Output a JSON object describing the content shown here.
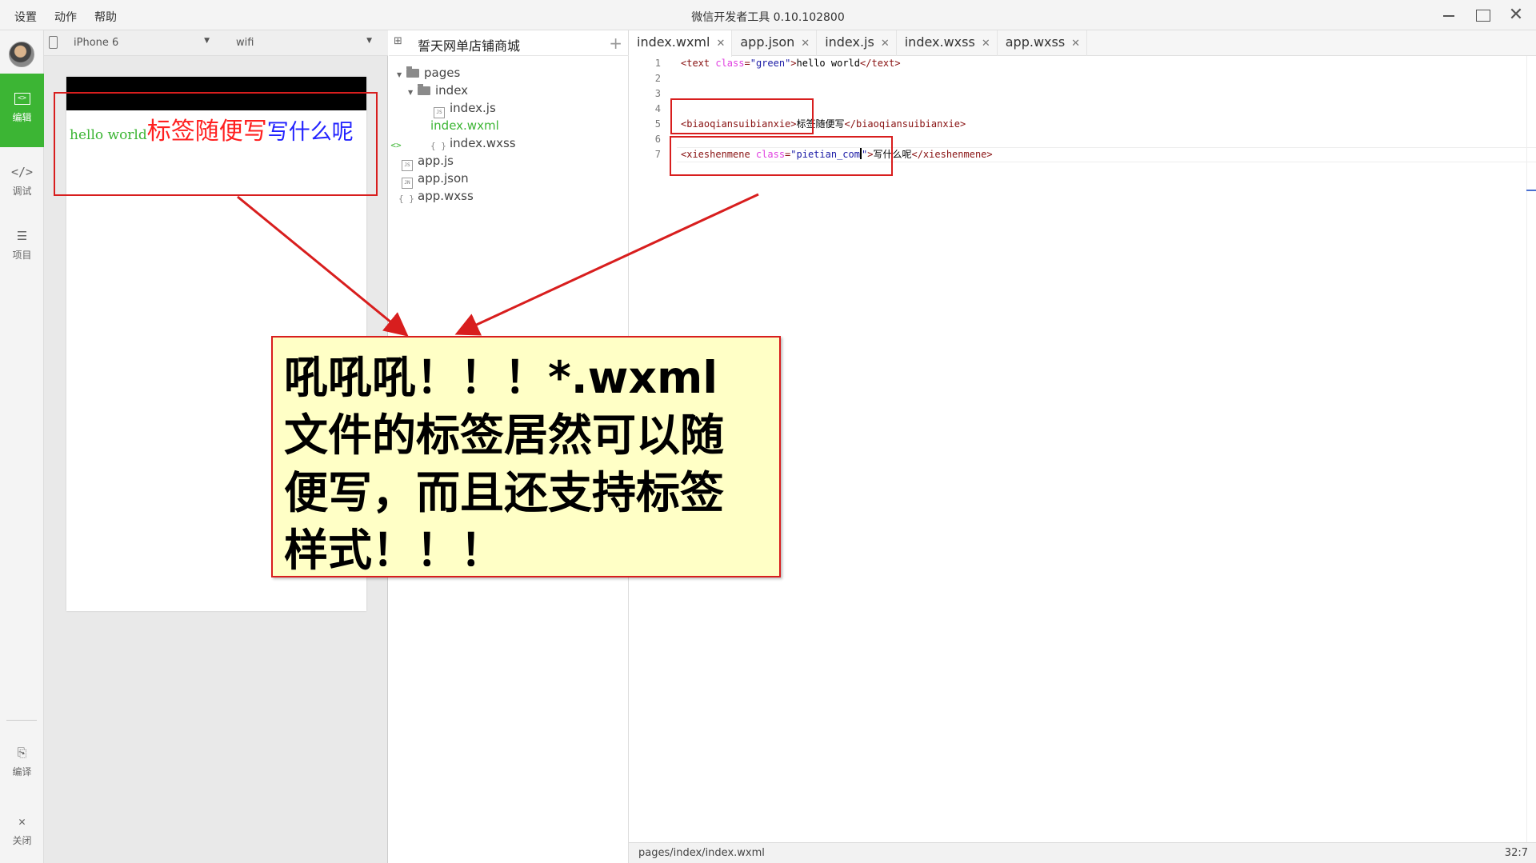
{
  "menu": {
    "settings": "设置",
    "action": "动作",
    "help": "帮助"
  },
  "window_title": "微信开发者工具 0.10.102800",
  "activity": {
    "edit": "编辑",
    "debug": "调试",
    "project": "项目",
    "compile": "编译",
    "close": "关闭"
  },
  "simulator": {
    "device": "iPhone 6",
    "network": "wifi",
    "green_text": "hello world",
    "red_text": "标签随便写",
    "blue_text": "写什么呢"
  },
  "project": {
    "name": "誓天网单店铺商城",
    "tree": {
      "pages": "pages",
      "index": "index",
      "index_js": "index.js",
      "index_wxml": "index.wxml",
      "index_wxss": "index.wxss",
      "app_js": "app.js",
      "app_json": "app.json",
      "app_wxss": "app.wxss"
    }
  },
  "tabs": [
    {
      "label": "index.wxml"
    },
    {
      "label": "app.json"
    },
    {
      "label": "index.js"
    },
    {
      "label": "index.wxss"
    },
    {
      "label": "app.wxss"
    }
  ],
  "code": {
    "line_numbers": [
      "1",
      "2",
      "3",
      "4",
      "5",
      "6",
      "7"
    ],
    "l1": {
      "open": "<text ",
      "attr": "class",
      "eq": "=",
      "val": "\"green\"",
      "close": ">",
      "text": "hello world",
      "end": "</text>"
    },
    "l5": {
      "open": "<biaoqiansuibianxie>",
      "text": "标签随便写",
      "end": "</biaoqiansuibianxie>"
    },
    "l7": {
      "open": "<xieshenmene ",
      "attr": "class",
      "eq": "=",
      "val_a": "\"pietian_com",
      "val_b": "\"",
      "close": ">",
      "text": "写什么呢",
      "end": "</xieshenmene>"
    }
  },
  "status": {
    "path": "pages/index/index.wxml",
    "position": "32:7"
  },
  "callout": {
    "line1": "吼吼吼！！！*.wxml",
    "line2": "文件的标签居然可以随",
    "line3": "便写，而且还支持标签",
    "line4": "样式！！！"
  },
  "colors": {
    "accent": "#3cb534",
    "annotation": "#d81e1e",
    "callout_bg": "#ffffc6"
  }
}
